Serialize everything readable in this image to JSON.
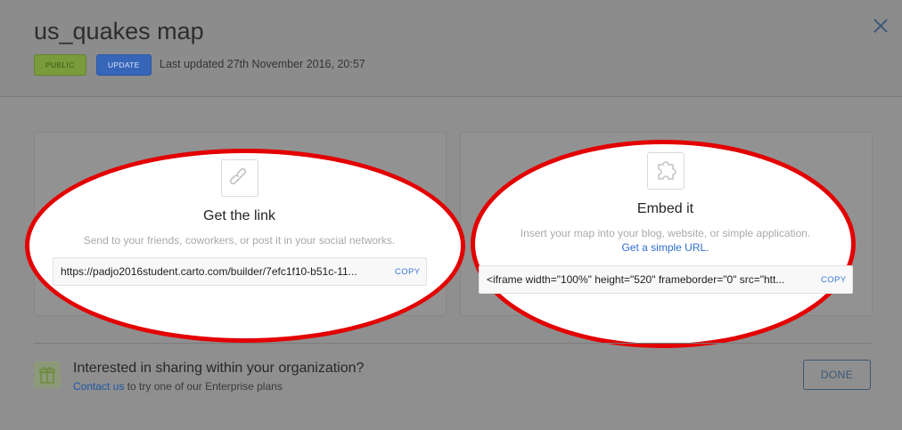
{
  "header": {
    "title": "us_quakes map",
    "public_badge": "PUBLIC",
    "update_button": "UPDATE",
    "last_updated": "Last updated 27th November 2016, 20:57"
  },
  "link_card": {
    "icon": "link-icon",
    "title": "Get the link",
    "description": "Send to your friends, coworkers, or post it in your social networks.",
    "url": "https://padjo2016student.carto.com/builder/7efc1f10-b51c-11...",
    "copy_label": "COPY"
  },
  "embed_card": {
    "icon": "puzzle-icon",
    "title": "Embed it",
    "description": "Insert your map into your blog, website, or simple application.",
    "link_text": "Get a simple URL.",
    "code": "<iframe width=\"100%\" height=\"520\" frameborder=\"0\" src=\"htt...",
    "copy_label": "COPY"
  },
  "footer": {
    "icon": "gift-icon",
    "title": "Interested in sharing within your organization?",
    "contact_link": "Contact us",
    "contact_rest": " to try one of our Enterprise plans",
    "done_button": "DONE"
  },
  "colors": {
    "highlight": "#e30000",
    "accent": "#3a78d6",
    "overlay": "#8f8f8f"
  }
}
